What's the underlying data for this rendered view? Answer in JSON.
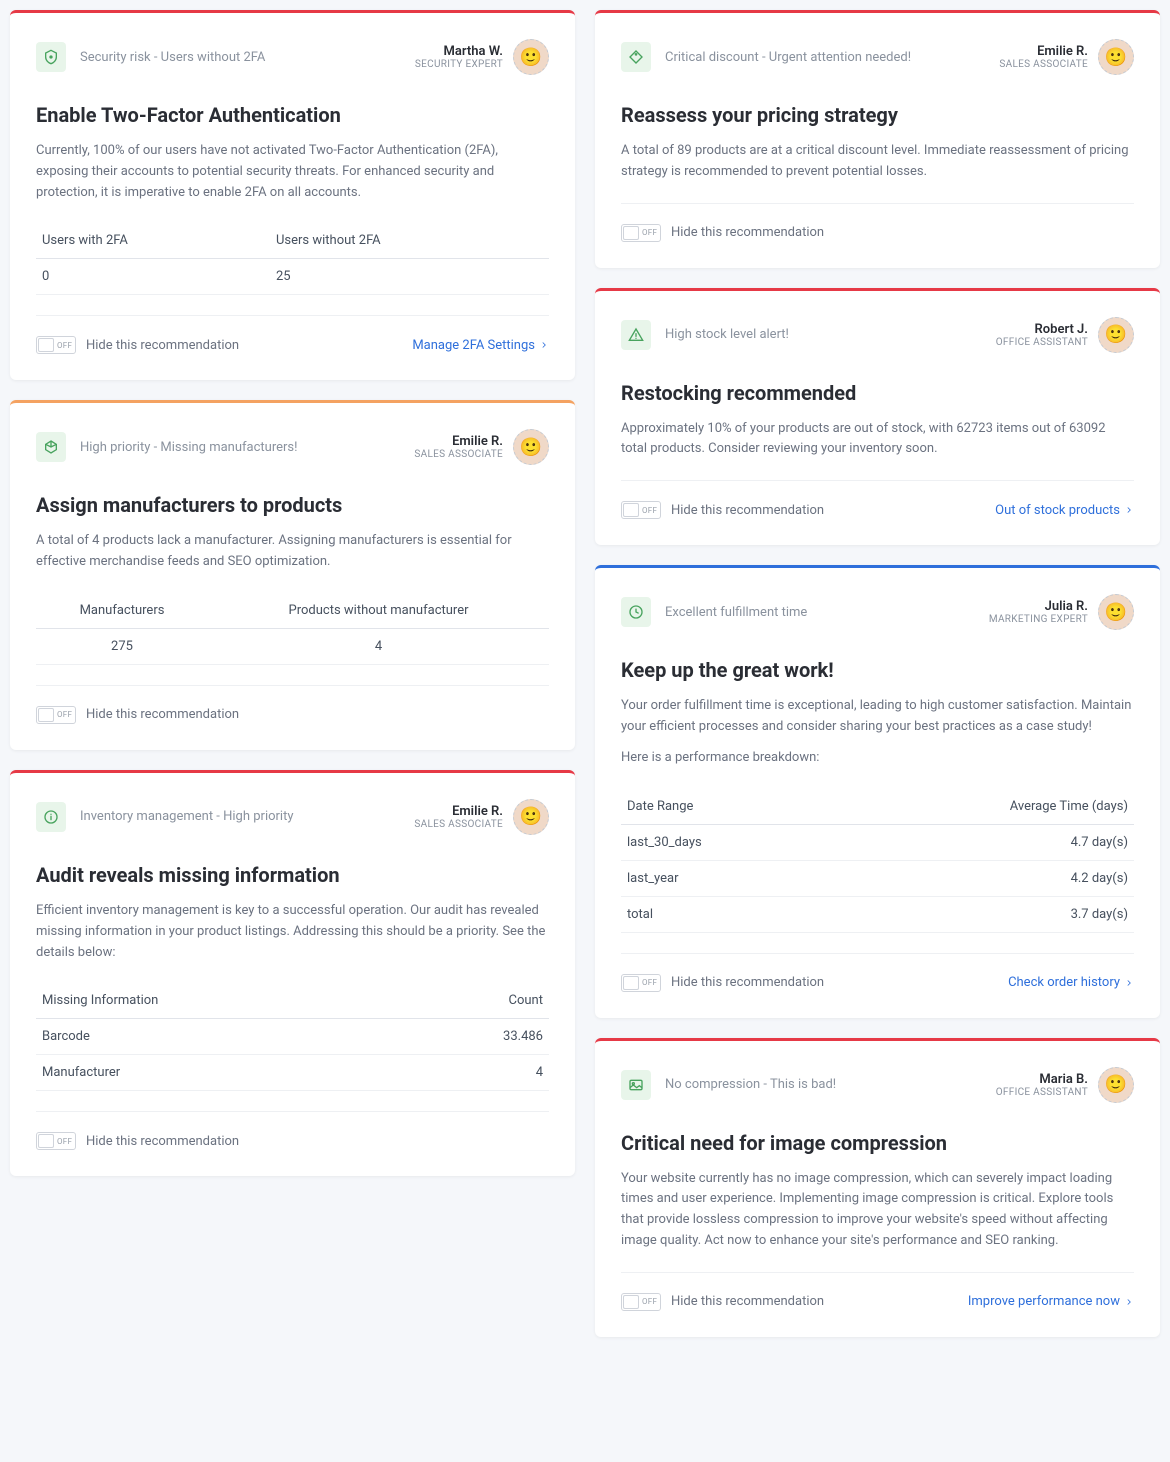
{
  "common": {
    "hide": "Hide this recommendation",
    "off": "OFF"
  },
  "cards": [
    {
      "id": "2fa",
      "col": 0,
      "color": "red",
      "icon": "shield",
      "tag": "Security risk - Users without 2FA",
      "author": {
        "name": "Martha W.",
        "role": "SECURITY EXPERT"
      },
      "title": "Enable Two-Factor Authentication",
      "desc": "Currently, 100% of our users have not activated Two-Factor Authentication (2FA), exposing their accounts to potential security threats. For enhanced security and protection, it is imperative to enable 2FA on all accounts.",
      "table": {
        "headers": [
          "Users with 2FA",
          "Users without 2FA"
        ],
        "rows": [
          [
            "0",
            "25"
          ]
        ]
      },
      "action": "Manage 2FA Settings"
    },
    {
      "id": "manufacturers",
      "col": 0,
      "color": "orange",
      "icon": "box",
      "tag": "High priority - Missing manufacturers!",
      "author": {
        "name": "Emilie R.",
        "role": "SALES ASSOCIATE"
      },
      "title": "Assign manufacturers to products",
      "desc": "A total of 4 products lack a manufacturer. Assigning manufacturers is essential for effective merchandise feeds and SEO optimization.",
      "table": {
        "headers": [
          "Manufacturers",
          "Products without manufacturer"
        ],
        "rows": [
          [
            "275",
            "4"
          ]
        ],
        "center": true
      }
    },
    {
      "id": "inventory",
      "col": 0,
      "color": "red",
      "icon": "info",
      "tag": "Inventory management - High priority",
      "author": {
        "name": "Emilie R.",
        "role": "SALES ASSOCIATE"
      },
      "title": "Audit reveals missing information",
      "desc": "Efficient inventory management is key to a successful operation. Our audit has revealed missing information in your product listings. Addressing this should be a priority. See the details below:",
      "table": {
        "headers": [
          "Missing Information",
          "Count"
        ],
        "rows": [
          [
            "Barcode",
            "33.486"
          ],
          [
            "Manufacturer",
            "4"
          ]
        ],
        "rightCol2": true
      }
    },
    {
      "id": "discount",
      "col": 1,
      "color": "red",
      "icon": "tag",
      "tag": "Critical discount - Urgent attention needed!",
      "author": {
        "name": "Emilie R.",
        "role": "SALES ASSOCIATE"
      },
      "title": "Reassess your pricing strategy",
      "desc": "A total of 89 products are at a critical discount level. Immediate reassessment of pricing strategy is recommended to prevent potential losses."
    },
    {
      "id": "stock",
      "col": 1,
      "color": "red",
      "icon": "alert",
      "tag": "High stock level alert!",
      "author": {
        "name": "Robert J.",
        "role": "OFFICE ASSISTANT"
      },
      "title": "Restocking recommended",
      "desc": "Approximately 10% of your products are out of stock, with 62723 items out of 63092 total products. Consider reviewing your inventory soon.",
      "action": "Out of stock products"
    },
    {
      "id": "fulfillment",
      "col": 1,
      "color": "blue",
      "icon": "clock",
      "tag": "Excellent fulfillment time",
      "author": {
        "name": "Julia R.",
        "role": "MARKETING EXPERT"
      },
      "title": "Keep up the great work!",
      "desc": "Your order fulfillment time is exceptional, leading to high customer satisfaction. Maintain your efficient processes and consider sharing your best practices as a case study!",
      "table_intro": "Here is a performance breakdown:",
      "table": {
        "headers": [
          "Date Range",
          "Average Time (days)"
        ],
        "rows": [
          [
            "last_30_days",
            "4.7 day(s)"
          ],
          [
            "last_year",
            "4.2 day(s)"
          ],
          [
            "total",
            "3.7 day(s)"
          ]
        ],
        "rightCol2": true
      },
      "action": "Check order history"
    },
    {
      "id": "compression",
      "col": 1,
      "color": "red",
      "icon": "image",
      "tag": "No compression - This is bad!",
      "author": {
        "name": "Maria B.",
        "role": "OFFICE ASSISTANT"
      },
      "title": "Critical need for image compression",
      "desc": "Your website currently has no image compression, which can severely impact loading times and user experience. Implementing image compression is critical. Explore tools that provide lossless compression to improve your website's speed without affecting image quality. Act now to enhance your site's performance and SEO ranking.",
      "action": "Improve performance now"
    }
  ]
}
